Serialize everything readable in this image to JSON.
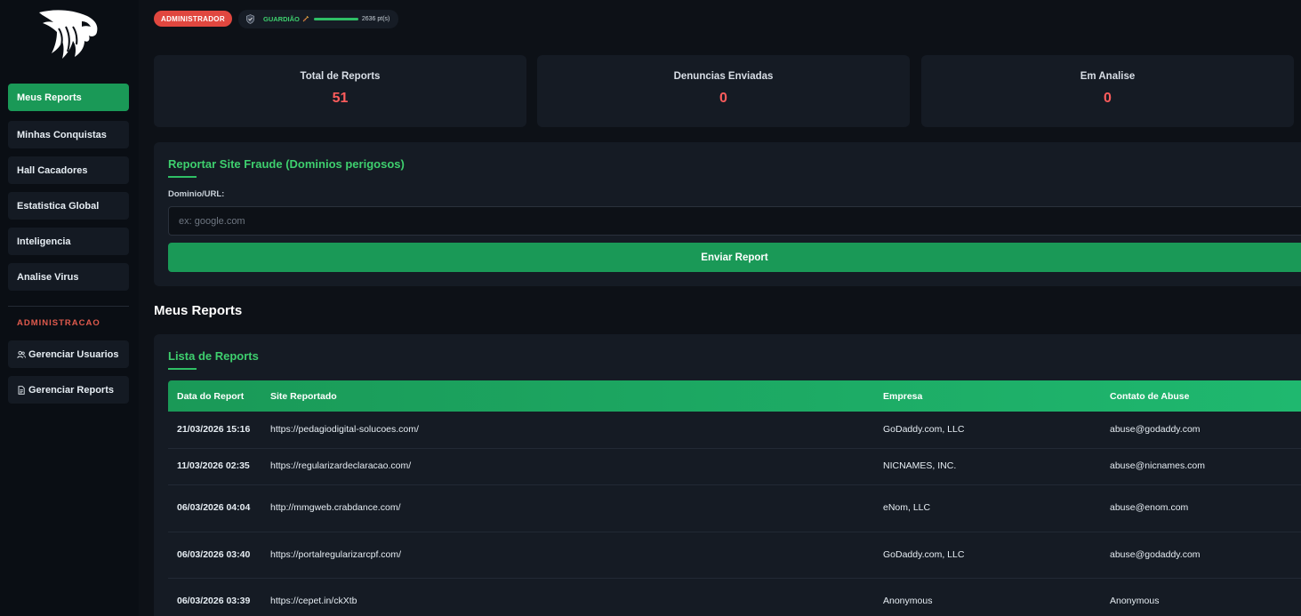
{
  "sidebar": {
    "nav": [
      {
        "label": "Meus Reports",
        "active": true
      },
      {
        "label": "Minhas Conquistas",
        "active": false
      },
      {
        "label": "Hall Cacadores",
        "active": false
      },
      {
        "label": "Estatistica Global",
        "active": false
      },
      {
        "label": "Inteligencia",
        "active": false
      },
      {
        "label": "Analise Virus",
        "active": false
      }
    ],
    "admin_section": "ADMINISTRACAO",
    "admin_nav": [
      {
        "label": "Gerenciar Usuarios",
        "icon": "users-icon"
      },
      {
        "label": "Gerenciar Reports",
        "icon": "document-icon"
      }
    ]
  },
  "topbar": {
    "role_badge": "ADMINISTRADOR",
    "rank": {
      "name": "GUARDIÃO",
      "points": "2636 pt(s)",
      "progress": 1.0
    }
  },
  "stats": [
    {
      "label": "Total de Reports",
      "value": "51"
    },
    {
      "label": "Denuncias Enviadas",
      "value": "0"
    },
    {
      "label": "Em Analise",
      "value": "0"
    }
  ],
  "report_form": {
    "title": "Reportar Site Fraude (Dominios perigosos)",
    "field_label": "Dominio/URL:",
    "placeholder": "ex: google.com",
    "value": "",
    "submit_label": "Enviar Report"
  },
  "my_reports_heading": "Meus Reports",
  "reports_list": {
    "title": "Lista de Reports",
    "columns": [
      "Data do Report",
      "Site Reportado",
      "Empresa",
      "Contato de Abuse"
    ],
    "rows": [
      {
        "date": "21/03/2026 15:16",
        "site": "https://pedagiodigital-solucoes.com/",
        "company": "GoDaddy.com, LLC",
        "abuse": "abuse@godaddy.com"
      },
      {
        "date": "11/03/2026 02:35",
        "site": "https://regularizardeclaracao.com/",
        "company": "NICNAMES, INC.",
        "abuse": "abuse@nicnames.com"
      },
      {
        "date": "06/03/2026 04:04",
        "site": "http://mmgweb.crabdance.com/",
        "company": "eNom, LLC",
        "abuse": "abuse@enom.com"
      },
      {
        "date": "06/03/2026 03:40",
        "site": "https://portalregularizarcpf.com/",
        "company": "GoDaddy.com, LLC",
        "abuse": "abuse@godaddy.com"
      },
      {
        "date": "06/03/2026 03:39",
        "site": "https://cepet.in/ckXtb",
        "company": "Anonymous",
        "abuse": "Anonymous"
      }
    ]
  },
  "colors": {
    "accent": "#1a9957",
    "accent_text": "#3ecf6e",
    "danger": "#ff5c5c",
    "bg": "#0d1117",
    "card": "#151b24"
  }
}
